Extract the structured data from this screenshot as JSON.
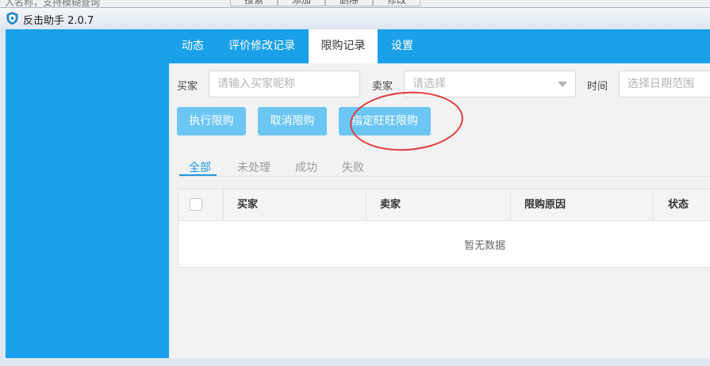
{
  "background_window": {
    "search_hint": "入名称，支持模糊查询",
    "buttons": [
      "搜索",
      "添加",
      "删除",
      "修改"
    ]
  },
  "window": {
    "title": "反击助手 2.0.7",
    "icon": "shield-icon"
  },
  "nav": {
    "tabs": [
      {
        "label": "动态"
      },
      {
        "label": "评价修改记录"
      },
      {
        "label": "限购记录"
      },
      {
        "label": "设置"
      }
    ],
    "active": "限购记录"
  },
  "filters": {
    "buyer_label": "买家",
    "buyer_placeholder": "请输入买家昵称",
    "seller_label": "卖家",
    "seller_placeholder": "请选择",
    "time_label": "时间",
    "time_placeholder": "选择日期范围"
  },
  "actions": {
    "execute": "执行限购",
    "cancel": "取消限购",
    "designate": "指定旺旺限购"
  },
  "subtabs": {
    "items": [
      "全部",
      "未处理",
      "成功",
      "失败"
    ],
    "active": "全部"
  },
  "table": {
    "columns": [
      "买家",
      "卖家",
      "限购原因",
      "状态"
    ],
    "empty_text": "暂无数据"
  },
  "colors": {
    "accent": "#1aa0e8",
    "button": "#6cc6f4",
    "annotation": "#e23a3a"
  }
}
